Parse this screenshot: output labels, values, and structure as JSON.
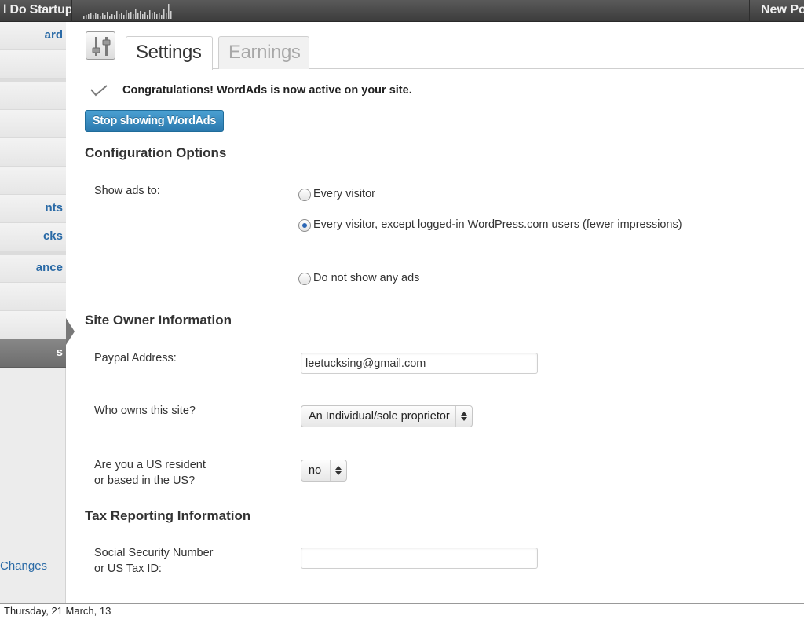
{
  "adminbar": {
    "site_name": "l Do Startup",
    "new_post": "New Pos"
  },
  "sidebar": {
    "items": [
      {
        "label": "ard"
      },
      {
        "label": "nts"
      },
      {
        "label": "cks"
      },
      {
        "label": "ance"
      },
      {
        "label": "s"
      },
      {
        "label": "Changes"
      }
    ]
  },
  "tabs": {
    "settings": "Settings",
    "earnings": "Earnings"
  },
  "notice": {
    "text": "Congratulations! WordAds is now active on your site."
  },
  "stop_button": "Stop showing WordAds",
  "config": {
    "heading": "Configuration Options",
    "show_ads_label": "Show ads to:",
    "options": [
      {
        "label": "Every visitor",
        "checked": false
      },
      {
        "label": "Every visitor, except logged-in WordPress.com users (fewer impressions)",
        "checked": true
      },
      {
        "label": "Do not show any ads",
        "checked": false
      }
    ]
  },
  "owner": {
    "heading": "Site Owner Information",
    "paypal_label": "Paypal Address:",
    "paypal_value": "leetucksing@gmail.com",
    "who_owns_label": "Who owns this site?",
    "who_owns_value": "An Individual/sole proprietor",
    "us_resident_label_line1": "Are you a US resident",
    "us_resident_label_line2": "or based in the US?",
    "us_resident_value": "no"
  },
  "tax": {
    "heading": "Tax Reporting Information",
    "ssn_label_line1": "Social Security Number",
    "ssn_label_line2": "or US Tax ID:",
    "ssn_value": ""
  },
  "caption": "Thursday, 21 March, 13",
  "colors": {
    "admin_bar": "#444444",
    "button_blue": "#2b79ae",
    "sidebar_link": "#2a6aa6"
  }
}
